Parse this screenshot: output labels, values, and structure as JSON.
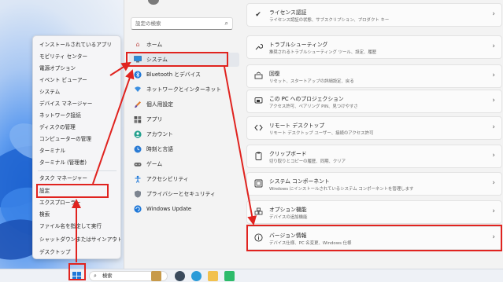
{
  "start_menu": {
    "items": [
      {
        "label": "インストールされているアプリ"
      },
      {
        "label": "モビリティ センター"
      },
      {
        "label": "電源オプション"
      },
      {
        "label": "イベント ビューアー"
      },
      {
        "label": "システム"
      },
      {
        "label": "デバイス マネージャー"
      },
      {
        "label": "ネットワーク接続"
      },
      {
        "label": "ディスクの管理"
      },
      {
        "label": "コンピューターの管理"
      },
      {
        "label": "ターミナル"
      },
      {
        "label": "ターミナル (管理者)"
      },
      {
        "label": "タスク マネージャー"
      },
      {
        "label": "設定"
      },
      {
        "label": "エクスプローラー"
      },
      {
        "label": "検索"
      },
      {
        "label": "ファイル名を指定して実行"
      },
      {
        "label": "シャットダウンまたはサインアウト"
      },
      {
        "label": "デスクトップ"
      }
    ]
  },
  "settings": {
    "search_placeholder": "設定の検索",
    "nav": [
      {
        "label": "ホーム",
        "icon": "home-icon"
      },
      {
        "label": "システム",
        "icon": "monitor-icon"
      },
      {
        "label": "Bluetooth とデバイス",
        "icon": "bluetooth-icon"
      },
      {
        "label": "ネットワークとインターネット",
        "icon": "network-icon"
      },
      {
        "label": "個人用設定",
        "icon": "brush-icon"
      },
      {
        "label": "アプリ",
        "icon": "apps-icon"
      },
      {
        "label": "アカウント",
        "icon": "account-icon"
      },
      {
        "label": "時刻と言語",
        "icon": "clock-globe-icon"
      },
      {
        "label": "ゲーム",
        "icon": "gamepad-icon"
      },
      {
        "label": "アクセシビリティ",
        "icon": "accessibility-icon"
      },
      {
        "label": "プライバシーとセキュリティ",
        "icon": "shield-icon"
      },
      {
        "label": "Windows Update",
        "icon": "update-icon"
      }
    ],
    "cards": [
      {
        "title": "ライセンス認証",
        "desc": "ライセンス認証の状態、サブスクリプション、プロダクト キー",
        "icon": "check-circle-icon"
      },
      {
        "title": "トラブルシューティング",
        "desc": "推奨されるトラブルシューティング ツール、設定、履歴",
        "icon": "wrench-icon"
      },
      {
        "title": "回復",
        "desc": "リセット、スタートアップの詳細設定、戻る",
        "icon": "recovery-icon"
      },
      {
        "title": "この PC へのプロジェクション",
        "desc": "アクセス許可、ペアリング PIN、見つけやすさ",
        "icon": "projection-icon"
      },
      {
        "title": "リモート デスクトップ",
        "desc": "リモート デスクトップ ユーザー、接続のアクセス許可",
        "icon": "remote-desktop-icon"
      },
      {
        "title": "クリップボード",
        "desc": "切り取りとコピーの履歴、同期、クリア",
        "icon": "clipboard-icon"
      },
      {
        "title": "システム コンポーネント",
        "desc": "Windows にインストールされているシステム コンポーネントを管理します",
        "icon": "components-icon"
      },
      {
        "title": "オプション機能",
        "desc": "デバイスの追加機能",
        "icon": "optional-features-icon"
      },
      {
        "title": "バージョン情報",
        "desc": "デバイス仕様、PC 名変更、Windows 仕様",
        "icon": "info-icon"
      }
    ]
  },
  "taskbar": {
    "search_label": "検索"
  },
  "colors": {
    "highlight_red": "#e0231f",
    "accent_blue": "#1f78d8"
  }
}
